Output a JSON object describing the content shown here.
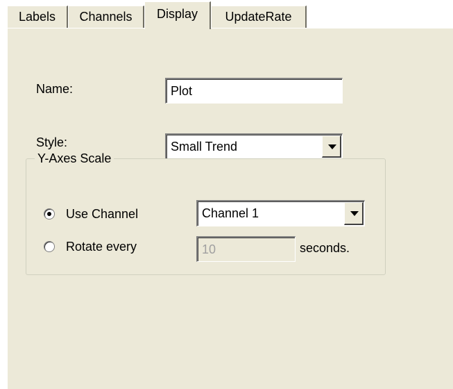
{
  "tabs": [
    {
      "label": "Labels"
    },
    {
      "label": "Channels"
    },
    {
      "label": "Display"
    },
    {
      "label": "UpdateRate"
    }
  ],
  "active_tab": "Display",
  "name_field": {
    "label": "Name:",
    "value": "Plot"
  },
  "style_field": {
    "label": "Style:",
    "value": "Small Trend"
  },
  "y_axes": {
    "title": "Y-Axes Scale",
    "use_channel": {
      "label": "Use Channel",
      "selected": true,
      "value": "Channel 1"
    },
    "rotate_every": {
      "label": "Rotate every",
      "selected": false,
      "value": "10",
      "unit": "seconds."
    }
  },
  "colors": {
    "panel": "#ece9d8",
    "text": "#000000",
    "disabled_text": "#a0a0a0"
  }
}
